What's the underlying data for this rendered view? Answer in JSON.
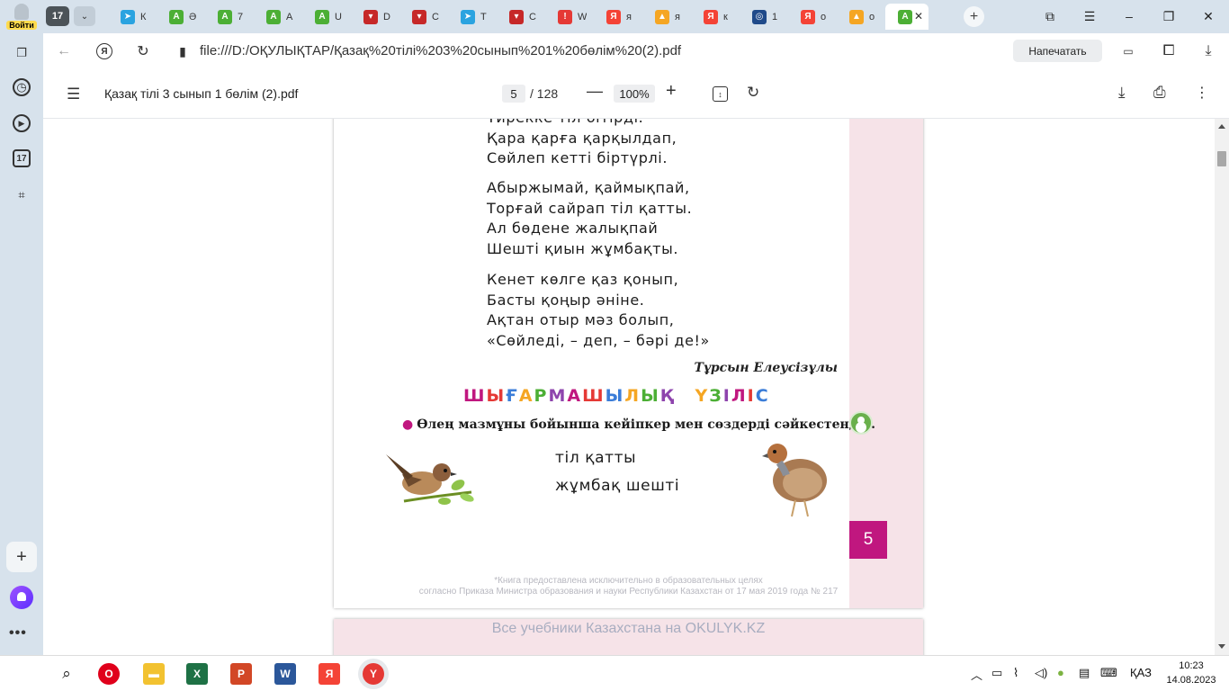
{
  "tabbar": {
    "login_label": "Войти",
    "tab_count": "17",
    "tabs": [
      {
        "title": "К",
        "favicon": "telegram-icon",
        "color": "#2aa3e0",
        "glyph": "➤"
      },
      {
        "title": "Ә",
        "favicon": "green-a-icon",
        "color": "#4caf35",
        "glyph": "A"
      },
      {
        "title": "7",
        "favicon": "green-a-icon",
        "color": "#4caf35",
        "glyph": "A"
      },
      {
        "title": "А",
        "favicon": "green-a-icon",
        "color": "#4caf35",
        "glyph": "A"
      },
      {
        "title": "U",
        "favicon": "green-a-icon",
        "color": "#4caf35",
        "glyph": "A"
      },
      {
        "title": "D",
        "favicon": "shield-red-icon",
        "color": "#c62828",
        "glyph": "▾"
      },
      {
        "title": "C",
        "favicon": "shield-red-icon",
        "color": "#c62828",
        "glyph": "▾"
      },
      {
        "title": "Т",
        "favicon": "telegram-icon",
        "color": "#2aa3e0",
        "glyph": "➤"
      },
      {
        "title": "C",
        "favicon": "shield-red-icon",
        "color": "#c62828",
        "glyph": "▾"
      },
      {
        "title": "W",
        "favicon": "alert-icon",
        "color": "#e53935",
        "glyph": "!"
      },
      {
        "title": "я",
        "favicon": "yandex-icon",
        "color": "#f44336",
        "glyph": "Я"
      },
      {
        "title": "я",
        "favicon": "image-icon",
        "color": "#f5a623",
        "glyph": "▲"
      },
      {
        "title": "к",
        "favicon": "yandex-icon",
        "color": "#f44336",
        "glyph": "Я"
      },
      {
        "title": "1",
        "favicon": "globe-icon",
        "color": "#1f4a8a",
        "glyph": "◎"
      },
      {
        "title": "о",
        "favicon": "yandex-icon",
        "color": "#f44336",
        "glyph": "Я"
      },
      {
        "title": "о",
        "favicon": "image-icon",
        "color": "#f5a623",
        "glyph": "▲"
      }
    ],
    "active_tab": {
      "favicon": "green-a-icon",
      "color": "#4caf35",
      "glyph": "A"
    }
  },
  "addressbar": {
    "url": "file:///D:/ОҚУЛЫҚТАР/Қазақ%20тілі%203%20сынып%201%20бөлім%20(2).pdf",
    "print_label": "Напечатать"
  },
  "sidebar": {
    "calendar_badge": "17"
  },
  "pdf": {
    "title": "Қазақ тілі 3 сынып 1 бөлім (2).pdf",
    "current_page": "5",
    "total_pages": "/ 128",
    "zoom": "100%"
  },
  "document": {
    "stanzas": [
      [
        "Үйрекке тіл бітірді.",
        "Қара қарға қарқылдап,",
        "Сөйлеп кетті біртүрлі."
      ],
      [
        "Абыржымай, қаймықпай,",
        "Торғай сайрап тіл қатты.",
        "Ал бөдене жалықпай",
        "Шешті қиын жұмбақты."
      ],
      [
        "Кенет көлге қаз қонып,",
        "Басты қоңыр әніне.",
        "Ақтан отыр мәз болып,",
        "«Сөйледі, – деп, – бәрі де!»"
      ]
    ],
    "author": "Тұрсын Елеусізұлы",
    "heading": {
      "word1": "ШЫҒАРМАШЫЛЫҚ",
      "word2": "ҮЗІЛІС",
      "colors": [
        "#c0177f",
        "#e53935",
        "#3b7dd8",
        "#f5a623",
        "#4caf35",
        "#8e44ad"
      ]
    },
    "task": "Өлең мазмұны бойынша кейіпкер мен сөздерді сәйкестендір.",
    "words": [
      "тіл қатты",
      "жұмбақ шешті"
    ],
    "page_number": "5",
    "footnote": [
      "*Книга предоставлена исключительно в образовательных целях",
      "согласно Приказа Министра образования и науки Республики Казахстан от 17 мая 2019 года № 217"
    ],
    "watermark": "Все учебники Казахстана на OKULYK.KZ"
  },
  "taskbar": {
    "language": "ҚАЗ",
    "time": "10:23",
    "date": "14.08.2023"
  }
}
